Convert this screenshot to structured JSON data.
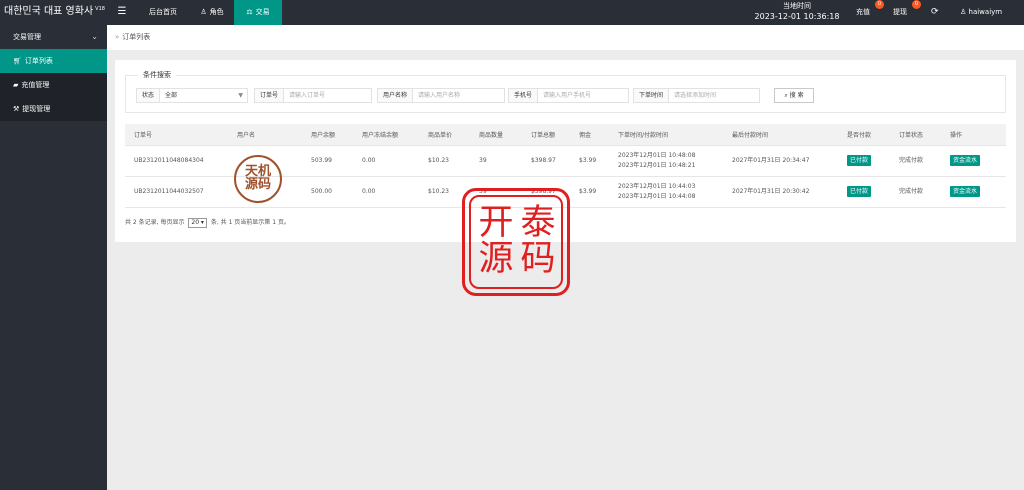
{
  "app": {
    "title": "대한민국 대표 영화사",
    "version": "V18"
  },
  "nav": {
    "menu_icon": "menu-icon",
    "tabs": [
      {
        "label": "后台首页",
        "icon": ""
      },
      {
        "label": "角色",
        "icon": "user-icon"
      },
      {
        "label": "交易",
        "icon": "balance-icon"
      }
    ]
  },
  "clock": {
    "label": "当地时间",
    "value": "2023-12-01 10:36:18"
  },
  "header_actions": {
    "recharge": {
      "label": "充值",
      "badge": "0"
    },
    "withdraw": {
      "label": "提现",
      "badge": "0"
    },
    "refresh_icon": "refresh-icon",
    "user": "haiwaiym"
  },
  "sidebar": {
    "section": "交易管理",
    "items": [
      {
        "label": "订单列表",
        "icon": "cart-icon"
      },
      {
        "label": "充值管理",
        "icon": "chat-icon"
      },
      {
        "label": "提现管理",
        "icon": "hammer-icon"
      }
    ]
  },
  "breadcrumb": "订单列表",
  "search": {
    "legend": "条件搜索",
    "status_label": "状态",
    "status_value": "全部",
    "order_label": "订单号",
    "order_placeholder": "请输入订单号",
    "user_label": "用户名称",
    "user_placeholder": "请输入用户名称",
    "phone_label": "手机号",
    "phone_placeholder": "请输入用户手机号",
    "time_label": "下单时间",
    "time_placeholder": "请选择添加时间",
    "button": "搜 索"
  },
  "table": {
    "headers": [
      "订单号",
      "用户名",
      "用户余额",
      "用户冻结余额",
      "商品单价",
      "商品数量",
      "订单总额",
      "佣金",
      "下单时间/付款时间",
      "最后付款时间",
      "是否付款",
      "订单状态",
      "操作"
    ],
    "rows": [
      {
        "order_no": "UB2312011048084304",
        "username": "",
        "balance": "503.99",
        "frozen": "0.00",
        "unit_price": "$10.23",
        "qty": "39",
        "total": "$398.97",
        "commission": "$3.99",
        "order_time": "2023年12月01日 10:48:08",
        "pay_time": "2023年12月01日 10:48:21",
        "last_pay": "2027年01月31日 20:34:47",
        "paid": "已付款",
        "status": "完成付款",
        "action": "资金流水"
      },
      {
        "order_no": "UB2312011044032507",
        "username": "",
        "balance": "500.00",
        "frozen": "0.00",
        "unit_price": "$10.23",
        "qty": "39",
        "total": "$398.97",
        "commission": "$3.99",
        "order_time": "2023年12月01日 10:44:03",
        "pay_time": "2023年12月01日 10:44:08",
        "last_pay": "2027年01月31日 20:30:42",
        "paid": "已付款",
        "status": "完成付款",
        "action": "资金流水"
      }
    ]
  },
  "pager": {
    "prefix": "共 2 条记录, 每页显示",
    "page_size": "20",
    "suffix": "条, 共 1 页当前显示第 1 页。"
  },
  "watermarks": {
    "small": [
      "天机",
      "源码"
    ],
    "large": [
      "开",
      "泰",
      "源",
      "码"
    ]
  },
  "colors": {
    "accent": "#009688",
    "topbar": "#2a2e36",
    "badge": "#ff5722",
    "stamp_red": "#e02020",
    "stamp_brown": "#a0522d"
  }
}
